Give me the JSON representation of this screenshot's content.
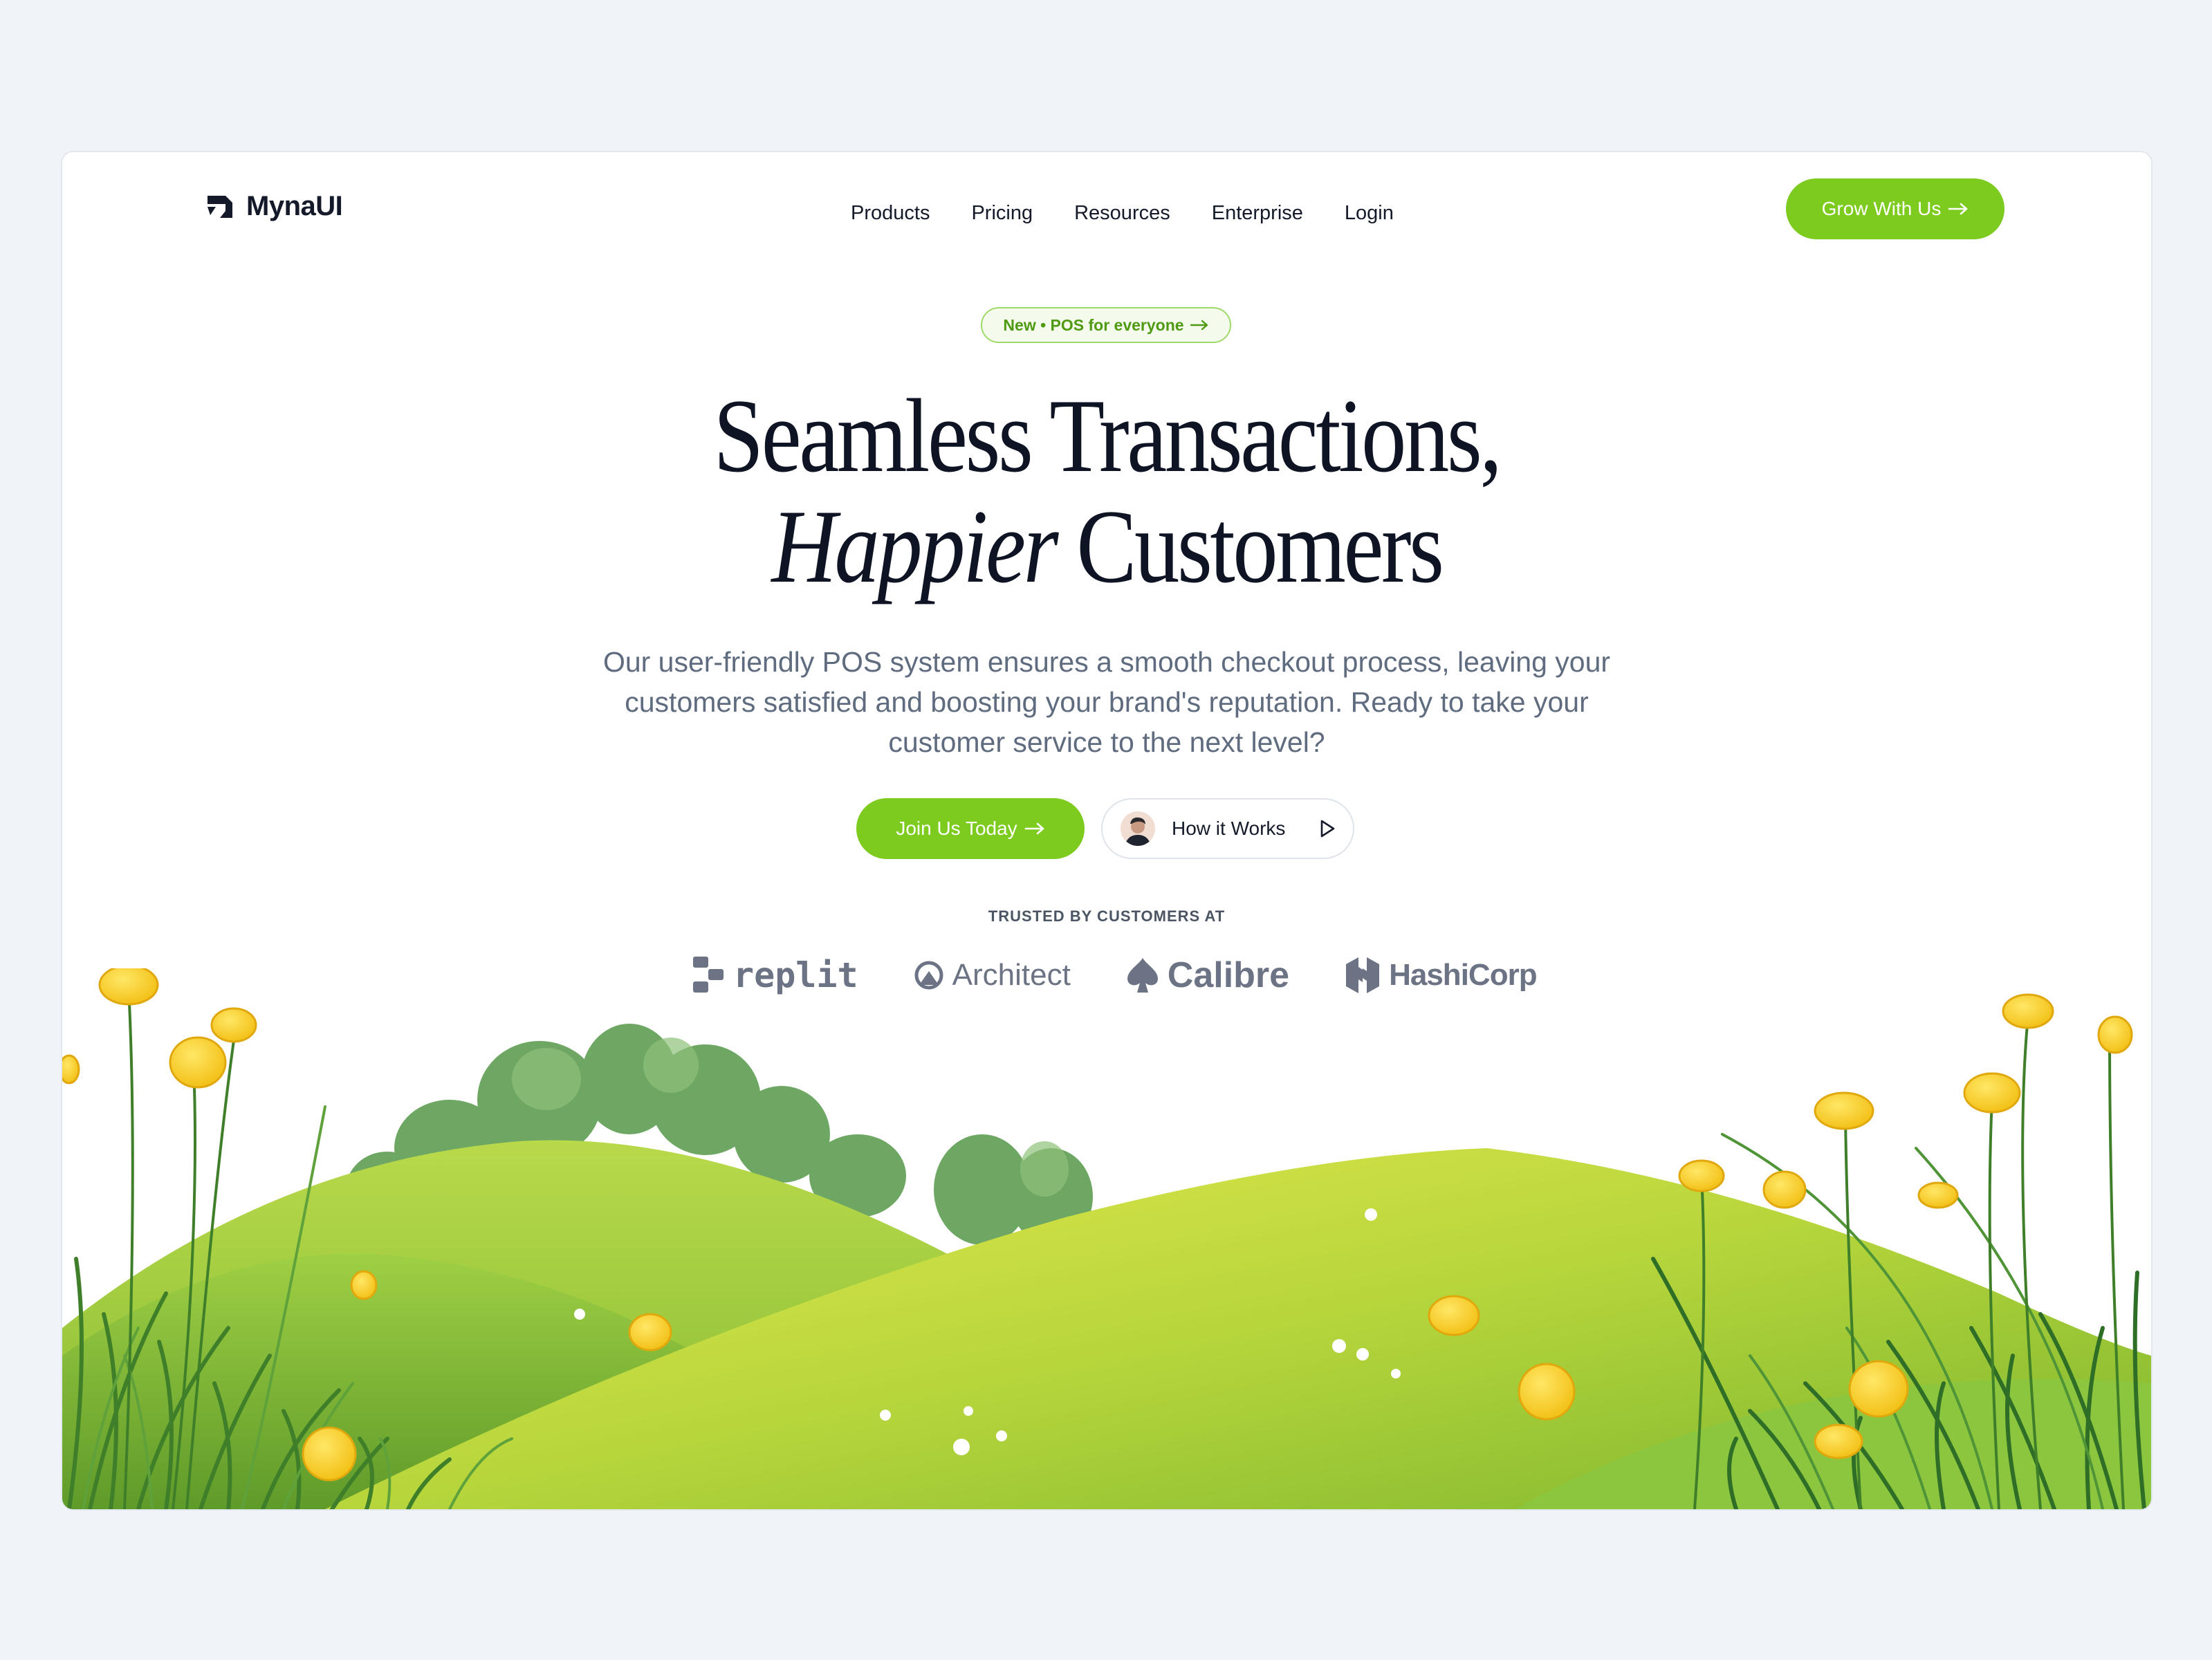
{
  "brand": {
    "name": "MynaUI"
  },
  "nav": {
    "items": [
      {
        "label": "Products"
      },
      {
        "label": "Pricing"
      },
      {
        "label": "Resources"
      },
      {
        "label": "Enterprise"
      },
      {
        "label": "Login"
      }
    ],
    "cta_label": "Grow With Us"
  },
  "hero": {
    "badge_label": "New • POS for everyone",
    "headline_line1": "Seamless Transactions,",
    "headline_italic": "Happier",
    "headline_rest": "Customers",
    "subtext": "Our user-friendly POS system ensures a smooth checkout process, leaving your customers satisfied and boosting your brand's reputation. Ready to take your customer service to the next level?",
    "primary_button_label": "Join Us Today",
    "secondary_button_label": "How it Works"
  },
  "trusted": {
    "heading": "TRUSTED BY CUSTOMERS AT",
    "logos": [
      {
        "name": "replit",
        "icon": "replit-icon"
      },
      {
        "name": "Architect",
        "icon": "architect-icon"
      },
      {
        "name": "Calibre",
        "icon": "spade-icon"
      },
      {
        "name": "HashiCorp",
        "icon": "hashicorp-icon"
      }
    ]
  },
  "colors": {
    "accent": "#7ccb1e",
    "heading": "#0f1424",
    "body_text": "#5f6b7e",
    "page_bg": "#f0f3f8"
  }
}
